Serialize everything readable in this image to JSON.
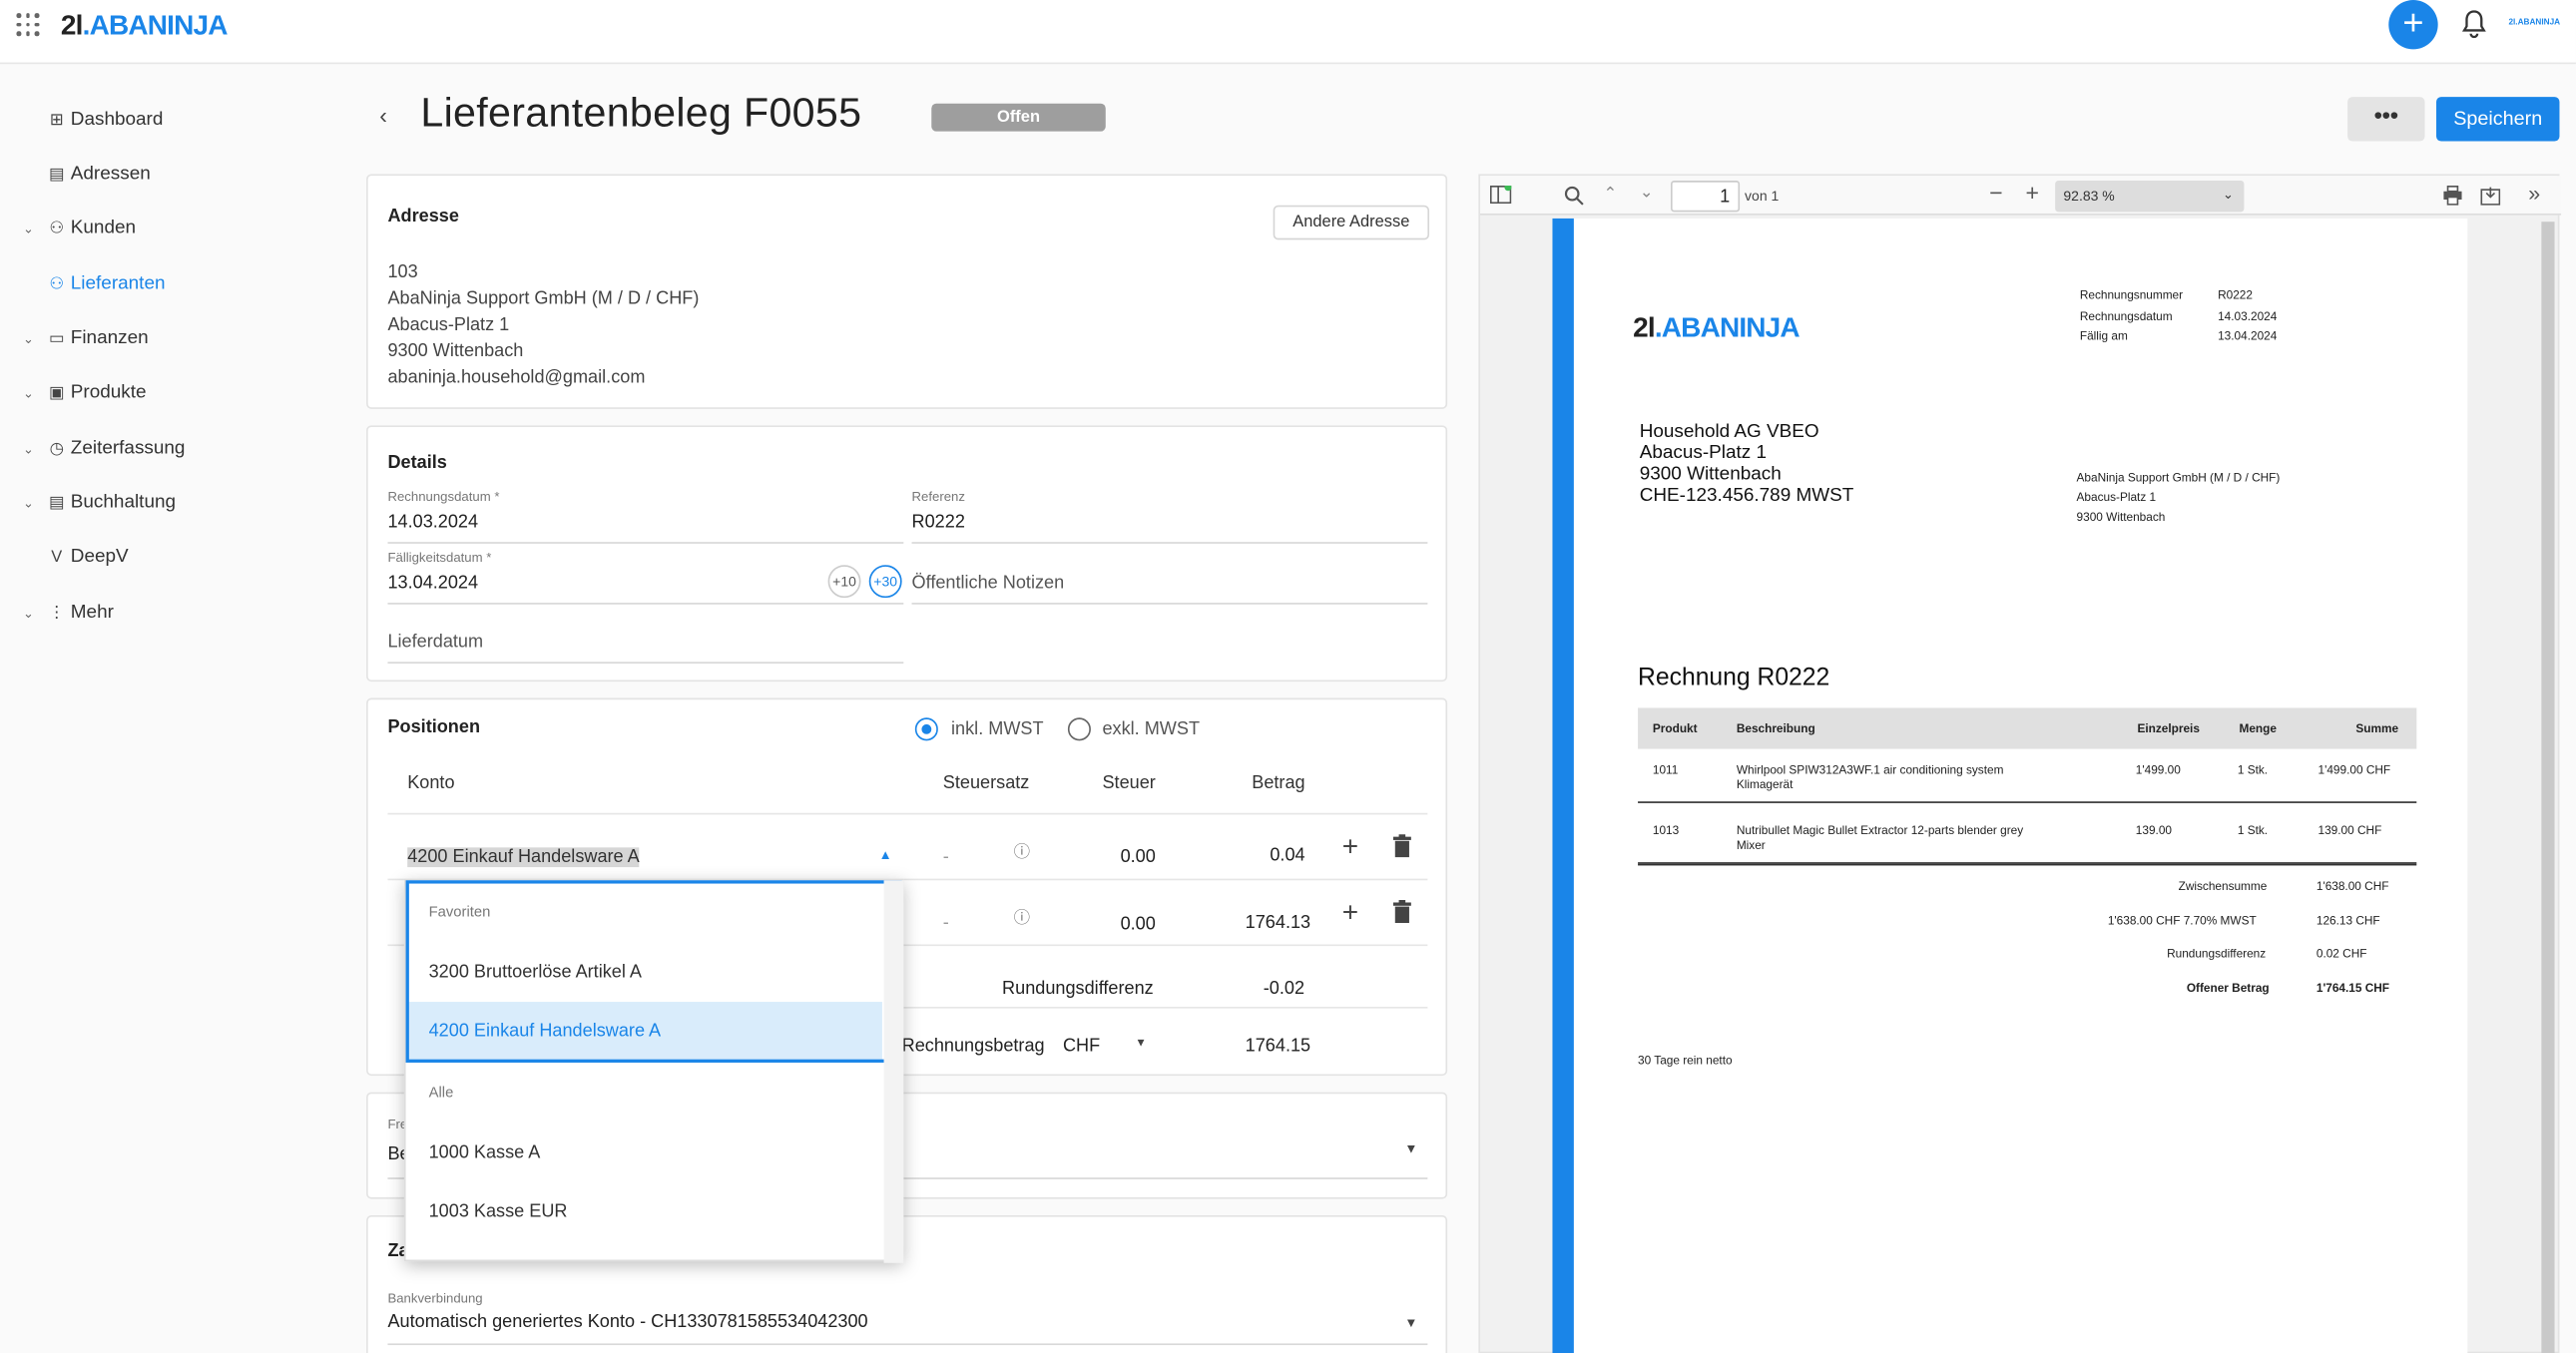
{
  "header": {
    "logo_num": "2l",
    "logo_dot": ".",
    "logo_text": "ABANINJA",
    "mini_logo": "2l.ABANINJA"
  },
  "sidebar": {
    "items": [
      {
        "label": "Dashboard",
        "icon": "dashboard-icon"
      },
      {
        "label": "Adressen",
        "icon": "contacts-icon"
      },
      {
        "label": "Kunden",
        "icon": "customers-icon",
        "expandable": true
      },
      {
        "label": "Lieferanten",
        "icon": "suppliers-icon",
        "active": true
      },
      {
        "label": "Finanzen",
        "icon": "finance-icon",
        "expandable": true
      },
      {
        "label": "Produkte",
        "icon": "products-icon",
        "expandable": true
      },
      {
        "label": "Zeiterfassung",
        "icon": "clock-icon",
        "expandable": true
      },
      {
        "label": "Buchhaltung",
        "icon": "accounting-icon",
        "expandable": true
      },
      {
        "label": "DeepV",
        "icon": "deepv-icon"
      },
      {
        "label": "Mehr",
        "icon": "more-vertical-icon",
        "expandable": true
      }
    ]
  },
  "page": {
    "title": "Lieferantenbeleg F0055",
    "status": "Offen",
    "more_label": "•••",
    "save_label": "Speichern"
  },
  "address": {
    "heading": "Adresse",
    "change_label": "Andere Adresse",
    "lines": [
      "103",
      "AbaNinja Support GmbH (M / D / CHF)",
      "Abacus-Platz 1",
      "9300 Wittenbach",
      "abaninja.household@gmail.com"
    ]
  },
  "details": {
    "heading": "Details",
    "invoice_date_label": "Rechnungsdatum *",
    "invoice_date": "14.03.2024",
    "reference_label": "Referenz",
    "reference": "R0222",
    "due_date_label": "Fälligkeitsdatum *",
    "due_date": "13.04.2024",
    "plus10": "+10",
    "plus30": "+30",
    "public_notes_placeholder": "Öffentliche Notizen",
    "delivery_date_placeholder": "Lieferdatum"
  },
  "positions": {
    "heading": "Positionen",
    "incl_label": "inkl. MWST",
    "excl_label": "exkl. MWST",
    "tax_mode": "inkl.",
    "col_account": "Konto",
    "col_taxrate": "Steuersatz",
    "col_tax": "Steuer",
    "col_amount": "Betrag",
    "rows": [
      {
        "account": "4200 Einkauf Handelsware A",
        "taxrate": "-",
        "tax": "0.00",
        "amount": "0.04"
      },
      {
        "account": "",
        "taxrate": "-",
        "tax": "0.00",
        "amount": "1764.13"
      }
    ],
    "rounding_label": "Rundungsdifferenz",
    "rounding_value": "-0.02",
    "total_label": "Rechnungsbetrag",
    "currency": "CHF",
    "total_value": "1764.15"
  },
  "dropdown": {
    "group_fav": "Favoriten",
    "group_all": "Alle",
    "items_fav": [
      "3200 Bruttoerlöse Artikel A",
      "4200 Einkauf Handelsware A"
    ],
    "items_all": [
      "1000 Kasse A",
      "1003 Kasse EUR"
    ],
    "selected": "4200 Einkauf Handelsware A"
  },
  "free": {
    "label_fragment": "Fre",
    "value_fragment": "Be"
  },
  "payment": {
    "heading_fragment": "Za",
    "bank_label": "Bankverbindung",
    "bank_value": "Automatisch generiertes Konto - CH1330781585534042300"
  },
  "pdf_viewer": {
    "page_number": "1",
    "page_total": "von 1",
    "zoom": "92.83 %"
  },
  "pdf": {
    "logo_num": "2l",
    "logo_dot": ".",
    "logo_text": "ABANINJA",
    "meta": [
      {
        "k": "Rechnungsnummer",
        "v": "R0222"
      },
      {
        "k": "Rechnungsdatum",
        "v": "14.03.2024"
      },
      {
        "k": "Fällig am",
        "v": "13.04.2024"
      }
    ],
    "recipient": [
      "Household AG VBEO",
      "Abacus-Platz 1",
      "9300 Wittenbach",
      "CHE-123.456.789 MWST"
    ],
    "sender": [
      "AbaNinja Support GmbH (M / D / CHF)",
      "Abacus-Platz 1",
      "9300 Wittenbach"
    ],
    "invoice_title": "Rechnung R0222",
    "cols": [
      "Produkt",
      "Beschreibung",
      "Einzelpreis",
      "Menge",
      "Summe"
    ],
    "items": [
      {
        "product": "1011",
        "desc1": "Whirlpool SPIW312A3WF.1 air conditioning system",
        "desc2": "Klimagerät",
        "price": "1'499.00",
        "qty": "1 Stk.",
        "sum": "1'499.00 CHF"
      },
      {
        "product": "1013",
        "desc1": "Nutribullet Magic Bullet Extractor 12-parts blender grey",
        "desc2": "Mixer",
        "price": "139.00",
        "qty": "1 Stk.",
        "sum": "139.00 CHF"
      }
    ],
    "totals": [
      {
        "k": "Zwischensumme",
        "v": "1'638.00 CHF"
      },
      {
        "k": "1'638.00 CHF 7.70% MWST",
        "v": "126.13 CHF"
      },
      {
        "k": "Rundungsdifferenz",
        "v": "0.02 CHF"
      },
      {
        "k": "Offener Betrag",
        "v": "1'764.15 CHF",
        "bold": true
      }
    ],
    "terms": "30 Tage rein netto"
  }
}
